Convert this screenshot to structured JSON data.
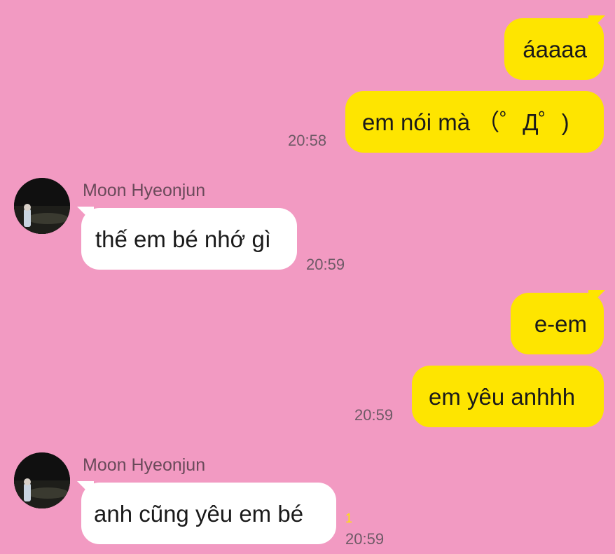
{
  "colors": {
    "background": "#f29ac2",
    "outgoing_bubble": "#fee500",
    "incoming_bubble": "#ffffff",
    "timestamp": "#6e5a66",
    "unread": "#fee500"
  },
  "messages": [
    {
      "direction": "out",
      "text": "áaaaa"
    },
    {
      "direction": "out",
      "text": "em nói mà （゜Д゜)",
      "time": "20:58"
    },
    {
      "direction": "in",
      "sender": "Moon Hyeonjun",
      "text": "thế em bé nhớ gì",
      "time": "20:59",
      "avatar_icon": "profile-photo-icon"
    },
    {
      "direction": "out",
      "text": "e-em"
    },
    {
      "direction": "out",
      "text": "em yêu anhhh",
      "time": "20:59"
    },
    {
      "direction": "in",
      "sender": "Moon Hyeonjun",
      "text": "anh cũng yêu em bé",
      "time": "20:59",
      "unread": "1",
      "avatar_icon": "profile-photo-icon"
    }
  ]
}
